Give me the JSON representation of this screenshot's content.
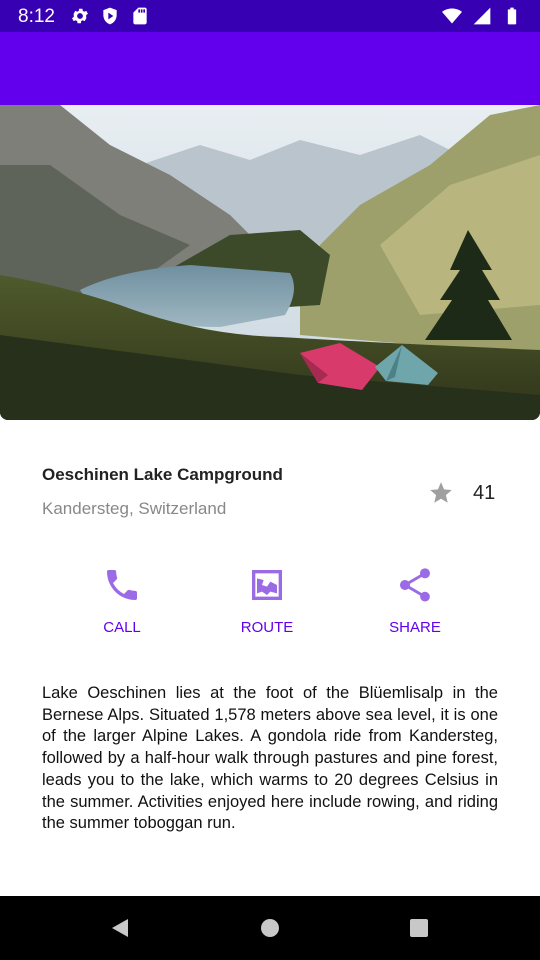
{
  "status_bar": {
    "time": "8:12",
    "left_icons": [
      "gear-icon",
      "shield-play-icon",
      "sd-card-icon"
    ],
    "right_icons": [
      "wifi-icon",
      "signal-icon",
      "battery-icon"
    ],
    "background": "#3700B3"
  },
  "app_bar": {
    "background": "#6200EE"
  },
  "hero": {
    "image": "mountain-lake-campground-photo"
  },
  "place": {
    "title": "Oeschinen Lake Campground",
    "location": "Kandersteg, Switzerland",
    "favorite_count": "41"
  },
  "actions": [
    {
      "label": "CALL",
      "icon": "phone-icon"
    },
    {
      "label": "ROUTE",
      "icon": "map-icon"
    },
    {
      "label": "SHARE",
      "icon": "share-icon"
    }
  ],
  "description": "Lake Oeschinen lies at the foot of the Blüemlisalp in the Bernese Alps. Situated 1,578 meters above sea level, it is one of the larger Alpine Lakes. A gondola ride from Kandersteg, followed by a half-hour walk through pastures and pine forest, leads you to the lake, which warms to 20 degrees Celsius in the summer. Activities enjoyed here include rowing, and riding the summer toboggan run.",
  "colors": {
    "accent": "#6200EE",
    "icon_tint": "#9b6be6"
  }
}
